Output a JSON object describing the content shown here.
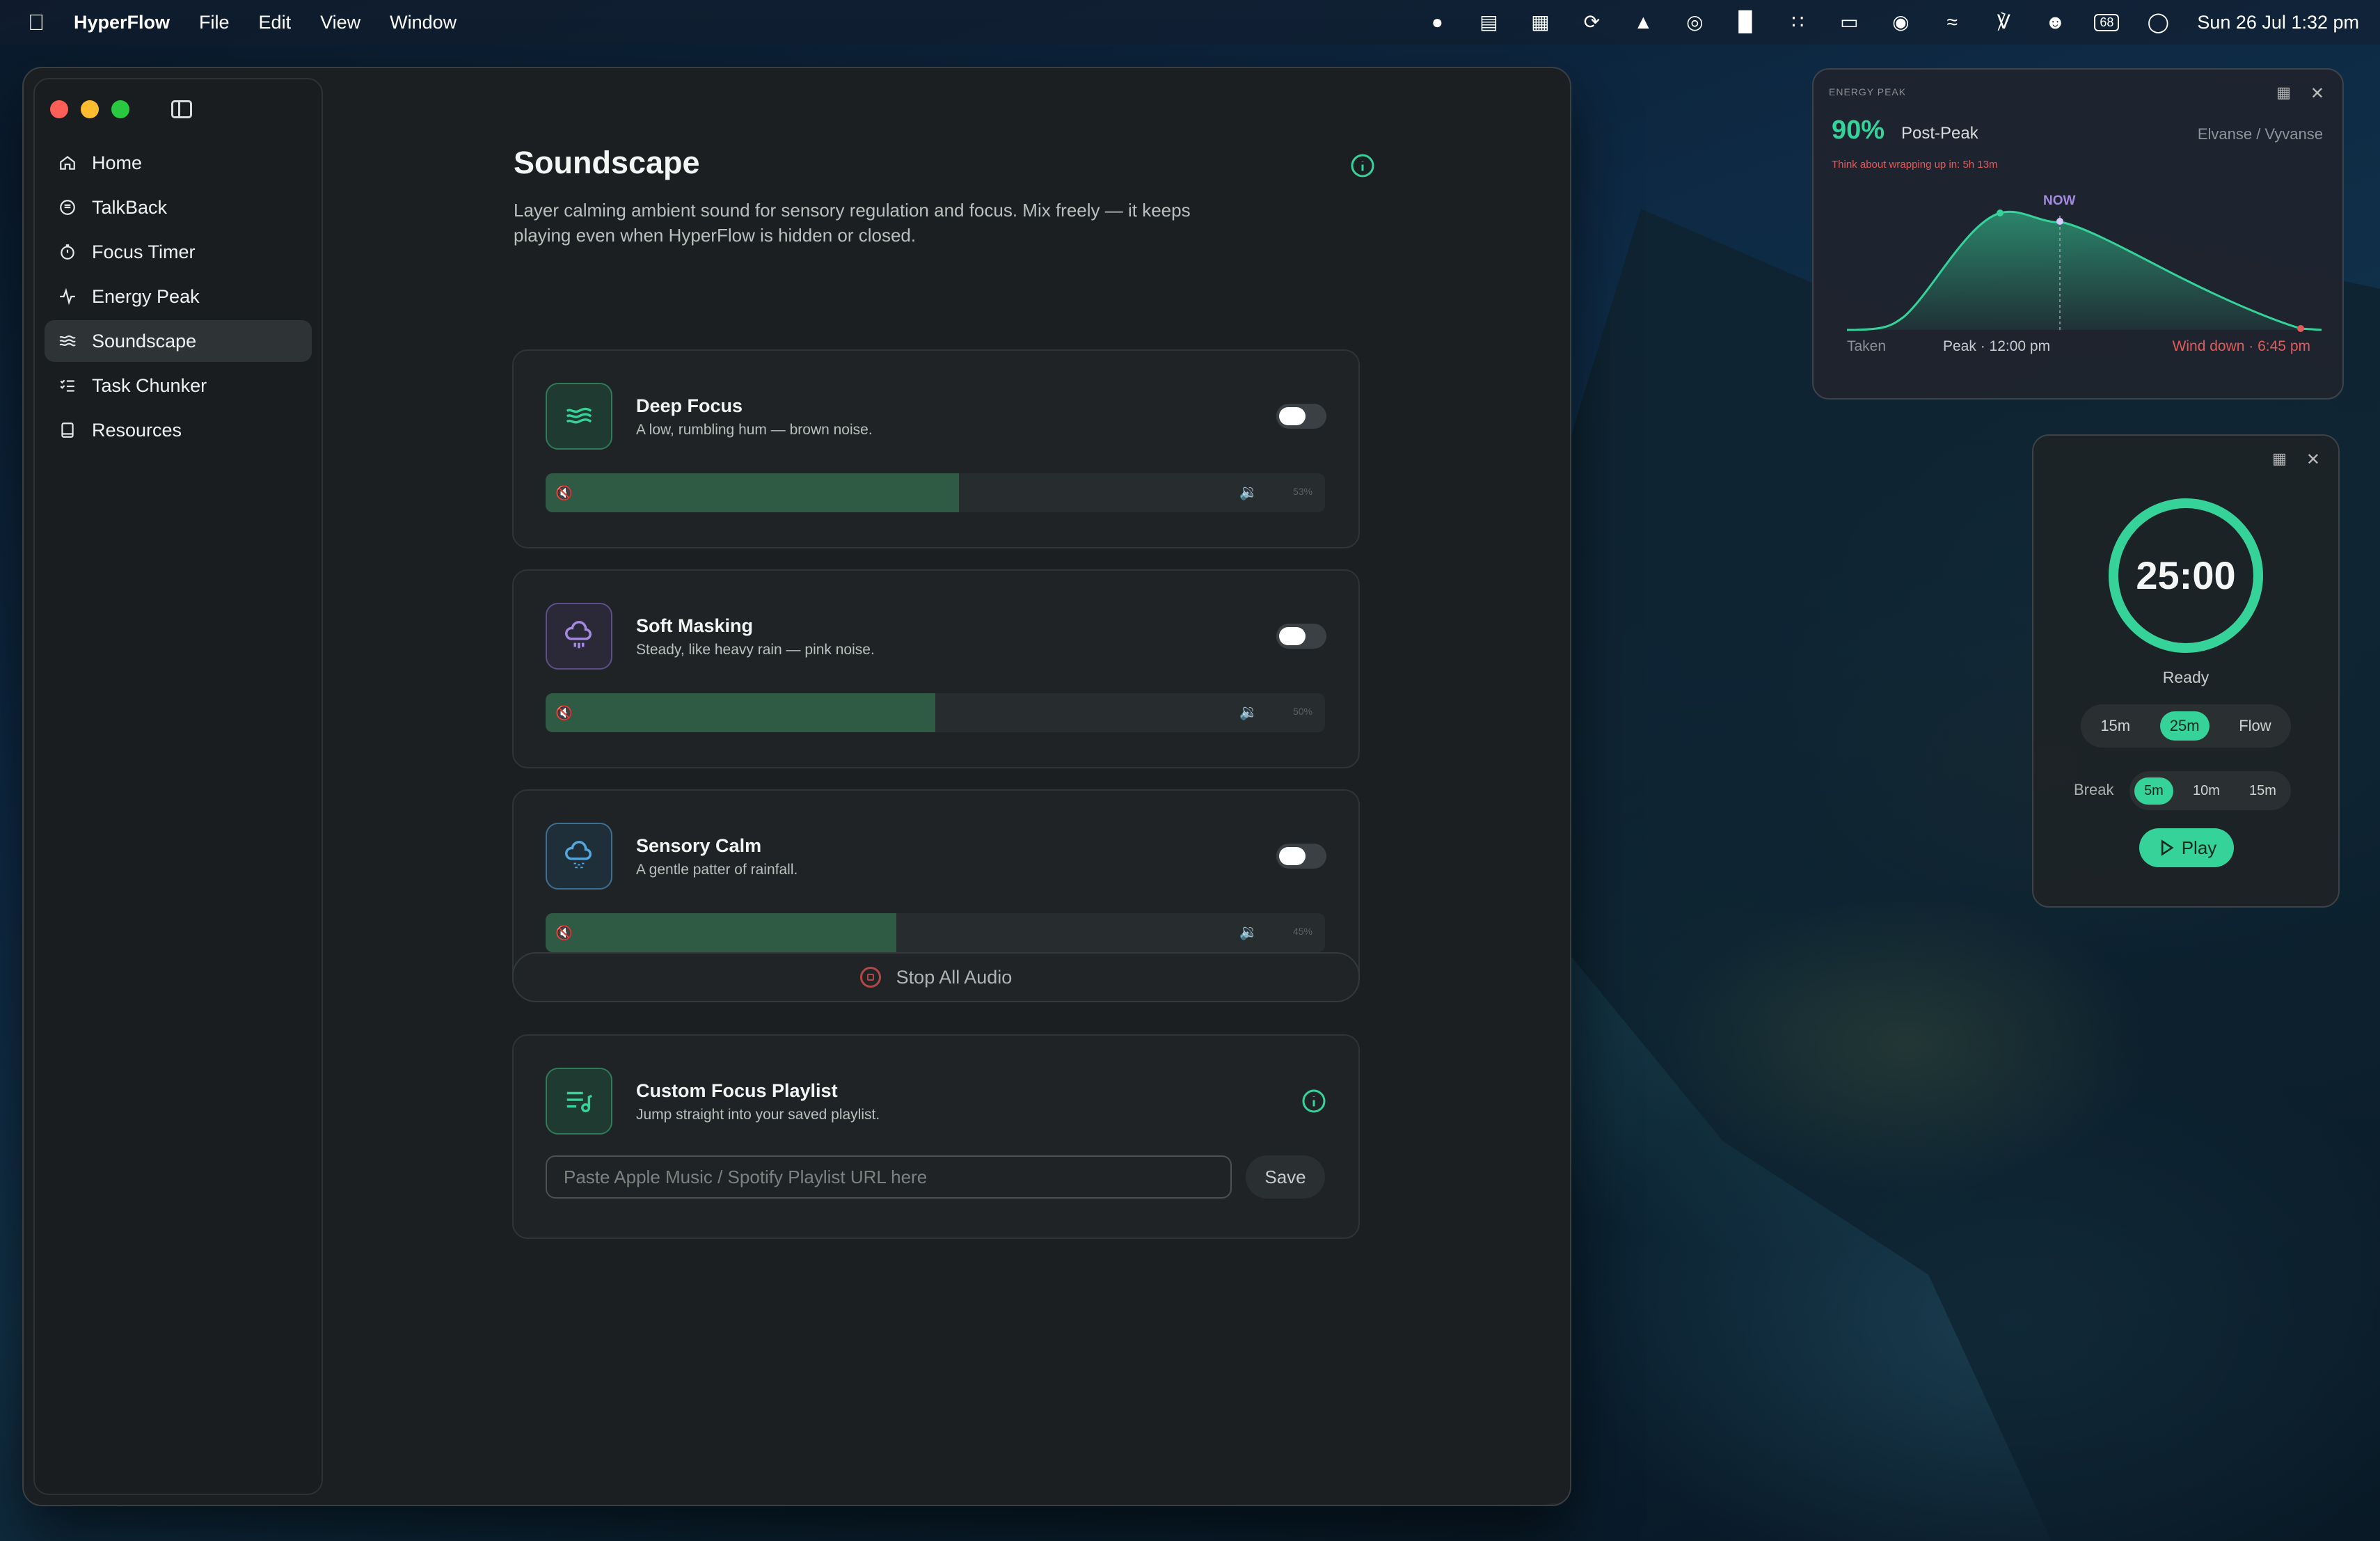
{
  "menubar": {
    "app": "HyperFlow",
    "menus": [
      "File",
      "Edit",
      "View",
      "Window"
    ],
    "clock": "Sun 26 Jul  1:32 pm",
    "battery": "68"
  },
  "sidebar": {
    "items": [
      {
        "label": "Home",
        "icon": "home-icon"
      },
      {
        "label": "TalkBack",
        "icon": "chat-icon"
      },
      {
        "label": "Focus Timer",
        "icon": "stopwatch-icon"
      },
      {
        "label": "Energy Peak",
        "icon": "pulse-icon"
      },
      {
        "label": "Soundscape",
        "icon": "waves-icon"
      },
      {
        "label": "Task Chunker",
        "icon": "checklist-icon"
      },
      {
        "label": "Resources",
        "icon": "book-icon"
      }
    ],
    "active": "Soundscape"
  },
  "page": {
    "title": "Soundscape",
    "description": "Layer calming ambient sound for sensory regulation and focus. Mix freely — it keeps playing even when HyperFlow is hidden or closed."
  },
  "sounds": [
    {
      "title": "Deep Focus",
      "subtitle": "A low, rumbling hum — brown noise.",
      "volume": 53,
      "volume_label": "53%",
      "accent": "#35d39a"
    },
    {
      "title": "Soft Masking",
      "subtitle": "Steady, like heavy rain — pink noise.",
      "volume": 50,
      "volume_label": "50%",
      "accent": "#a58be0"
    },
    {
      "title": "Sensory Calm",
      "subtitle": "A gentle patter of rainfall.",
      "volume": 45,
      "volume_label": "45%",
      "accent": "#55a7e0"
    }
  ],
  "stop_all": {
    "label": "Stop All Audio"
  },
  "playlist": {
    "title": "Custom Focus Playlist",
    "subtitle": "Jump straight into your saved playlist.",
    "placeholder": "Paste Apple Music / Spotify Playlist URL here",
    "save_label": "Save"
  },
  "energy_widget": {
    "label": "ENERGY PEAK",
    "percent": "90%",
    "state": "Post-Peak",
    "medication": "Elvanse / Vyvanse",
    "warning": "Think about wrapping up in: 5h 13m",
    "now_label": "NOW",
    "taken_label": "Taken",
    "peak_label": "Peak · 12:00 pm",
    "wind_label": "Wind down · 6:45 pm",
    "accent": "#35d39a",
    "warn_color": "#e25b5b"
  },
  "timer_widget": {
    "time": "25:00",
    "status": "Ready",
    "durations": [
      "15m",
      "25m",
      "Flow"
    ],
    "selected_duration": "25m",
    "break_label": "Break",
    "breaks": [
      "5m",
      "10m",
      "15m"
    ],
    "selected_break": "5m",
    "play_label": "Play",
    "progress": 1.0
  }
}
